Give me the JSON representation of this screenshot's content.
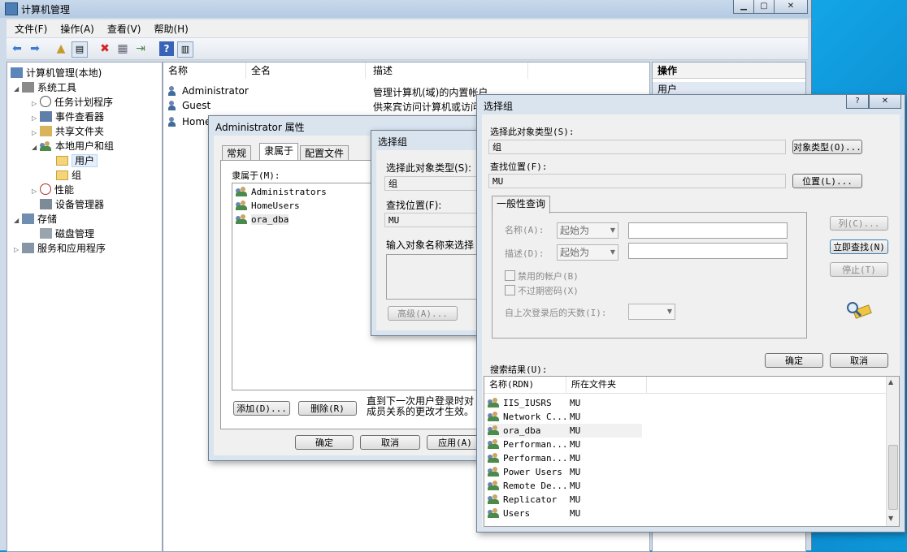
{
  "main": {
    "title": "计算机管理",
    "menu": [
      "文件(F)",
      "操作(A)",
      "查看(V)",
      "帮助(H)"
    ],
    "tree": [
      {
        "label": "计算机管理(本地)"
      },
      {
        "label": "系统工具"
      },
      {
        "label": "任务计划程序"
      },
      {
        "label": "事件查看器"
      },
      {
        "label": "共享文件夹"
      },
      {
        "label": "本地用户和组"
      },
      {
        "label": "用户"
      },
      {
        "label": "组"
      },
      {
        "label": "性能"
      },
      {
        "label": "设备管理器"
      },
      {
        "label": "存储"
      },
      {
        "label": "磁盘管理"
      },
      {
        "label": "服务和应用程序"
      }
    ],
    "list_headers": [
      "名称",
      "全名",
      "描述"
    ],
    "list_rows": [
      {
        "name": "Administrator",
        "desc": "管理计算机(域)的内置帐户"
      },
      {
        "name": "Guest",
        "desc": "供来宾访问计算机或访问"
      },
      {
        "name": "Home"
      }
    ],
    "actions_title": "操作",
    "actions_item": "用户"
  },
  "props_dialog": {
    "title": "Administrator 属性",
    "tabs": [
      "常规",
      "隶属于",
      "配置文件"
    ],
    "member_of_label": "隶属于(M):",
    "groups": [
      "Administrators",
      "HomeUsers",
      "ora_dba"
    ],
    "note_line1": "直到下一次用户登录时对",
    "note_line2": "成员关系的更改才生效。",
    "add_btn": "添加(D)...",
    "remove_btn": "删除(R)",
    "ok_btn": "确定",
    "cancel_btn": "取消",
    "apply_btn": "应用(A)"
  },
  "select_group_small": {
    "title": "选择组",
    "obj_type_label": "选择此对象类型(S):",
    "obj_type_value": "组",
    "location_label": "查找位置(F):",
    "location_value": "MU",
    "enter_label": "输入对象名称来选择",
    "advanced_btn": "高级(A)..."
  },
  "select_group": {
    "title": "选择组",
    "help_btn": "?",
    "obj_type_label": "选择此对象类型(S):",
    "obj_type_value": "组",
    "obj_type_btn": "对象类型(O)...",
    "location_label": "查找位置(F):",
    "location_value": "MU",
    "location_btn": "位置(L)...",
    "query_tab": "一般性查询",
    "name_label": "名称(A):",
    "name_mode": "起始为",
    "desc_label": "描述(D):",
    "desc_mode": "起始为",
    "disabled_chk": "禁用的帐户(B)",
    "noexpire_chk": "不过期密码(X)",
    "days_label": "自上次登录后的天数(I):",
    "columns_btn": "列(C)...",
    "find_now_btn": "立即查找(N)",
    "stop_btn": "停止(T)",
    "ok_btn": "确定",
    "cancel_btn": "取消",
    "results_label": "搜索结果(U):",
    "results_headers": [
      "名称(RDN)",
      "所在文件夹"
    ],
    "results": [
      {
        "name": "IIS_IUSRS",
        "folder": "MU"
      },
      {
        "name": "Network C...",
        "folder": "MU"
      },
      {
        "name": "ora_dba",
        "folder": "MU"
      },
      {
        "name": "Performan...",
        "folder": "MU"
      },
      {
        "name": "Performan...",
        "folder": "MU"
      },
      {
        "name": "Power Users",
        "folder": "MU"
      },
      {
        "name": "Remote De...",
        "folder": "MU"
      },
      {
        "name": "Replicator",
        "folder": "MU"
      },
      {
        "name": "Users",
        "folder": "MU"
      }
    ]
  },
  "colors": {
    "selection": "#e3effa",
    "window_frame": "#cfdbe8",
    "desktop": "#0a8fd1"
  }
}
